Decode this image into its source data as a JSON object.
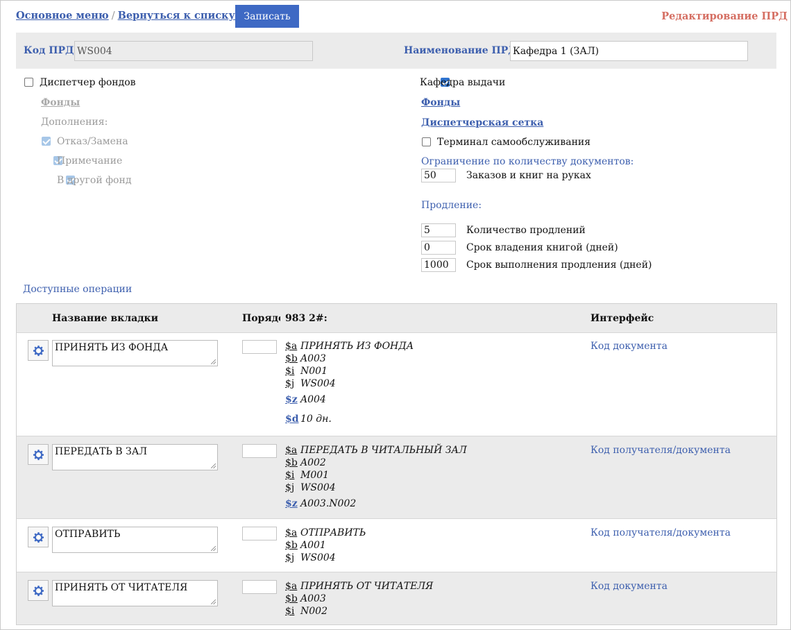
{
  "nav": {
    "main_menu": "Основное меню",
    "separator": "/",
    "back_to_list": "Вернуться к списку ПРД",
    "save_button": "Записать",
    "page_title": "Редактирование ПРД"
  },
  "header": {
    "code_label": "Код ПРД",
    "code_value": "WS004",
    "name_label": "Наименование ПРД",
    "name_value": "Кафедра 1 (ЗАЛ)"
  },
  "left": {
    "dispatcher_label": "Диспетчер фондов",
    "dispatcher_checked": false,
    "funds_link": "Фонды",
    "additions_label": "Дополнения:",
    "additions": [
      {
        "label": "Отказ/Замена",
        "checked": true
      },
      {
        "label": "Примечание",
        "checked": true
      },
      {
        "label": "В другой фонд",
        "checked": true
      }
    ]
  },
  "right": {
    "desk_label": "Кафедра выдачи",
    "desk_checked": true,
    "funds_link": "Фонды",
    "dispatch_grid_link": "Диспетчерская сетка",
    "terminal_label": "Терминал самообслуживания",
    "terminal_checked": false,
    "limit_title": "Ограничение по количеству документов:",
    "limit_value": "50",
    "limit_label": "Заказов и книг на руках",
    "renewal_title": "Продление:",
    "renewals": [
      {
        "value": "5",
        "label": "Количество продлений"
      },
      {
        "value": "0",
        "label": "Срок владения книгой (дней)"
      },
      {
        "value": "1000",
        "label": "Срок выполнения продления (дней)"
      }
    ]
  },
  "ops": {
    "title": "Доступные операции",
    "columns": {
      "tab_name": "Название вкладки",
      "order": "Порядок",
      "field": "983 2#:",
      "interface": "Интерфейс"
    },
    "rows": [
      {
        "name": "ПРИНЯТЬ ИЗ ФОНДА",
        "interface": "Код документа",
        "subfields": [
          {
            "code": "$a",
            "value": "ПРИНЯТЬ ИЗ ФОНДА"
          },
          {
            "code": "$b",
            "value": "A003"
          },
          {
            "code": "$i",
            "value": "N001"
          },
          {
            "code": "$j",
            "value": "WS004"
          },
          {
            "code": "$z",
            "value": "A004"
          },
          {
            "code": "$d",
            "value": "10 дн."
          }
        ]
      },
      {
        "name": "ПЕРЕДАТЬ В ЗАЛ",
        "interface": "Код получателя/документа",
        "subfields": [
          {
            "code": "$a",
            "value": "ПЕРЕДАТЬ В ЧИТАЛЬНЫЙ ЗАЛ"
          },
          {
            "code": "$b",
            "value": "A002"
          },
          {
            "code": "$i",
            "value": "M001"
          },
          {
            "code": "$j",
            "value": "WS004"
          },
          {
            "code": "$z",
            "value": "A003.N002"
          }
        ]
      },
      {
        "name": "ОТПРАВИТЬ",
        "interface": "Код получателя/документа",
        "subfields": [
          {
            "code": "$a",
            "value": "ОТПРАВИТЬ"
          },
          {
            "code": "$b",
            "value": "A001"
          },
          {
            "code": "$j",
            "value": "WS004"
          }
        ]
      },
      {
        "name": "ПРИНЯТЬ ОТ ЧИТАТЕЛЯ",
        "interface": "Код документа",
        "subfields": [
          {
            "code": "$a",
            "value": "ПРИНЯТЬ ОТ ЧИТАТЕЛЯ"
          },
          {
            "code": "$b",
            "value": "A003"
          },
          {
            "code": "$i",
            "value": "N002"
          }
        ]
      }
    ]
  },
  "colors": {
    "link": "#3d5fae",
    "save_button": "#3e69c4",
    "page_title": "#d56f63",
    "band": "#ebebeb"
  }
}
